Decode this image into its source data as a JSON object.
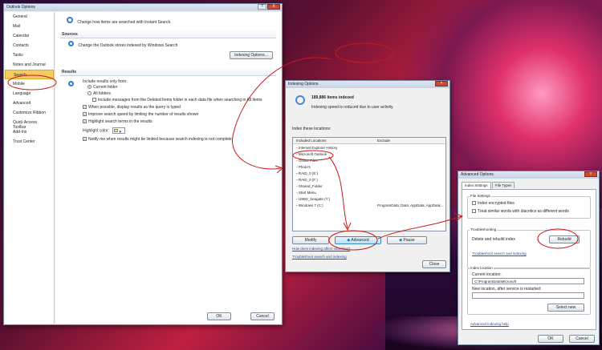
{
  "outlook": {
    "title": "Outlook Options",
    "close": "X",
    "sidebar": [
      "General",
      "Mail",
      "Calendar",
      "Contacts",
      "Tasks",
      "Notes and Journal",
      "Search",
      "Mobile",
      "Language",
      "Advanced",
      "Customize Ribbon",
      "Quick Access Toolbar",
      "Add-Ins",
      "Trust Center"
    ],
    "header": "Change how items are searched with Instant Search.",
    "sources_heading": "Sources",
    "sources_text": "Change the Outlook stores indexed by Windows Search",
    "indexing_button": "Indexing Options...",
    "results_heading": "Results",
    "include_label": "Include results only from:",
    "current_folder": "Current folder",
    "all_folders": "All folders",
    "deleted_items": "Include messages from the Deleted Items folder in each data file when searching in All Items",
    "opt_display": "When possible, display results as the query is typed",
    "opt_improve": "Improve search speed by limiting the number of results shown",
    "opt_highlight": "Highlight search terms in the results",
    "highlight_color_label": "Highlight color:",
    "opt_notify": "Notify me when results might be limited because search indexing is not complete",
    "ok": "OK",
    "cancel": "Cancel"
  },
  "indexing": {
    "title": "Indexing Options",
    "items_count": "189,886 items indexed",
    "status": "Indexing speed is reduced due to user activity.",
    "index_label": "Index these locations:",
    "col_included": "Included Locations",
    "col_exclude": "Exclude",
    "locations": [
      "Internet Explorer History",
      "Microsoft Outlook",
      "Offline Files",
      "Photo's",
      "RAID_0 (E:)",
      "RAID_0 (F:)",
      "Shared_Folder",
      "Start Menu",
      "USB2_Seagate (Y:)",
      "Windows 7 (C:)"
    ],
    "windows_exclude": "ProgramData; Data; AppData; AppData;...",
    "modify": "Modify",
    "advanced": "Advanced",
    "pause": "Pause",
    "link_affect": "How does indexing affect searches?",
    "link_trouble": "Troubleshoot search and indexing",
    "close": "Close"
  },
  "advanced": {
    "title": "Advanced Options",
    "tab_settings": "Index Settings",
    "tab_types": "File Types",
    "file_settings": "File Settings",
    "encrypted": "Index encrypted files",
    "diacritics": "Treat similar words with diacritics as different words",
    "troubleshooting": "Troubleshooting",
    "delete_rebuild": "Delete and rebuild index",
    "rebuild": "Rebuild",
    "link_trouble": "Troubleshoot search and indexing",
    "index_location": "Index location",
    "current_location_label": "Current location:",
    "current_location": "C:\\ProgramData\\Microsoft",
    "new_location_label": "New location, after service is restarted:",
    "select_new": "Select new",
    "help_link": "Advanced indexing help",
    "ok": "OK",
    "cancel": "Cancel"
  },
  "colors": {
    "selection": "#f5cc60",
    "annotation": "#c81a1a",
    "link": "#1f4fb0"
  }
}
